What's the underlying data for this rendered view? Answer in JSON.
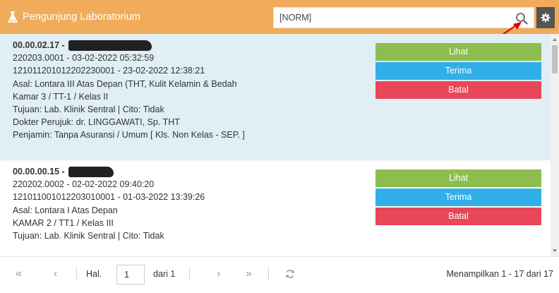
{
  "header": {
    "title": "Pengunjung Laboratorium",
    "color": "#f0ac5a",
    "title_icon": "flask-icon"
  },
  "search": {
    "value": "[NORM]",
    "icon": "search-icon",
    "settings_icon": "gear-icon"
  },
  "list": {
    "items": [
      {
        "selected": true,
        "id_name": "00.00.02.17 -",
        "line1": "220203.0001 - 03-02-2022 05:32:59",
        "line2": "121011201012202230001 - 23-02-2022 12:38:21",
        "asal": "Asal: Lontara III Atas Depan (THT, Kulit Kelamin & Bedah",
        "kamar": "Kamar 3 / TT-1 / Kelas II",
        "tujuan": "Tujuan: Lab. Klinik Sentral | Cito: Tidak",
        "dokter": "Dokter Perujuk: dr. LINGGAWATI, Sp. THT",
        "penjamin": "Penjamin: Tanpa Asuransi / Umum [ Kls. Non Kelas - SEP. ]",
        "lihat": "Lihat",
        "terima": "Terima",
        "batal": "Batal"
      },
      {
        "selected": false,
        "id_name": "00.00.00.15 -",
        "line1": "220202.0002 - 02-02-2022 09:40:20",
        "line2": "121011001012203010001 - 01-03-2022 13:39:26",
        "asal": "Asal: Lontara I Atas Depan",
        "kamar": "KAMAR 2 / TT1 / Kelas III",
        "tujuan": "Tujuan: Lab. Klinik Sentral | Cito: Tidak",
        "lihat": "Lihat",
        "terima": "Terima",
        "batal": "Batal"
      }
    ]
  },
  "pager": {
    "first": "«",
    "prev": "‹",
    "page_label": "Hal.",
    "page_value": "1",
    "of_label": "dari 1",
    "next": "›",
    "last": "»",
    "refresh_icon": "refresh-icon",
    "status": "Menampilkan 1 - 17 dari 17"
  },
  "colors": {
    "lihat": "#8cbe4f",
    "terima": "#31afe8",
    "batal": "#e74759",
    "selected_row": "#e0eef5"
  }
}
